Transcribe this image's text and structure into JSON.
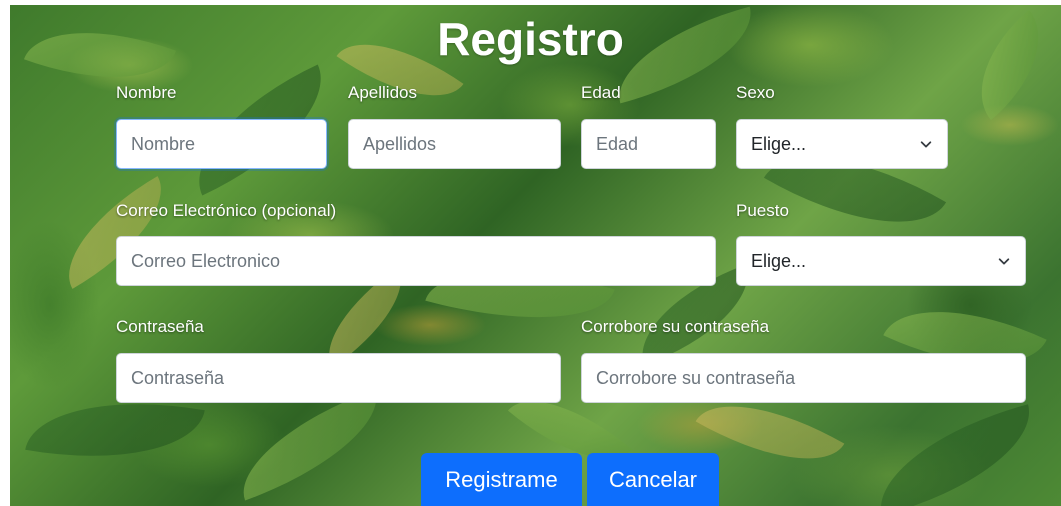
{
  "form": {
    "title": "Registro",
    "nombre": {
      "label": "Nombre",
      "placeholder": "Nombre"
    },
    "apellidos": {
      "label": "Apellidos",
      "placeholder": "Apellidos"
    },
    "edad": {
      "label": "Edad",
      "placeholder": "Edad"
    },
    "sexo": {
      "label": "Sexo",
      "selected": "Elige..."
    },
    "correo": {
      "label": "Correo Electrónico (opcional)",
      "placeholder": "Correo Electronico"
    },
    "puesto": {
      "label": "Puesto",
      "selected": "Elige..."
    },
    "contrasena": {
      "label": "Contraseña",
      "placeholder": "Contraseña"
    },
    "confirmar": {
      "label": "Corrobore su contraseña",
      "placeholder": "Corrobore su contraseña"
    }
  },
  "buttons": {
    "register": "Registrame",
    "cancel": "Cancelar",
    "color": "#0d6efd"
  }
}
